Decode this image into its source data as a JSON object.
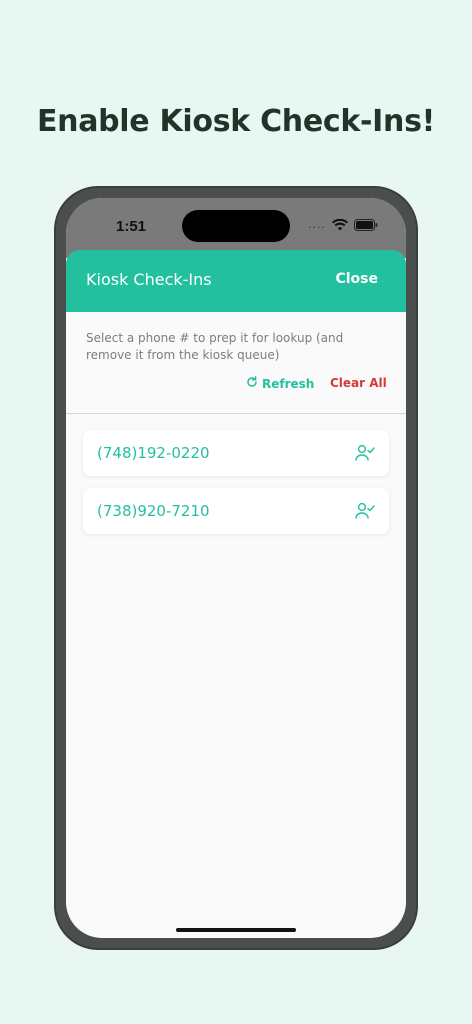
{
  "headline": "Enable Kiosk Check-Ins!",
  "status_bar": {
    "time": "1:51",
    "signal_dots": "....",
    "icons": [
      "wifi-icon",
      "battery-icon"
    ]
  },
  "sheet": {
    "title": "Kiosk Check-Ins",
    "close_label": "Close",
    "instructions": "Select a phone # to prep it for lookup (and remove it from the kiosk queue)",
    "refresh_label": "Refresh",
    "clear_all_label": "Clear All"
  },
  "checkins": [
    {
      "phone": "(748)192-0220",
      "icon": "user-check-icon"
    },
    {
      "phone": "(738)920-7210",
      "icon": "user-check-icon"
    }
  ],
  "colors": {
    "accent": "#23c09f",
    "danger": "#d23a3a",
    "background": "#e8f7f2",
    "frame": "#4a4e4c"
  }
}
